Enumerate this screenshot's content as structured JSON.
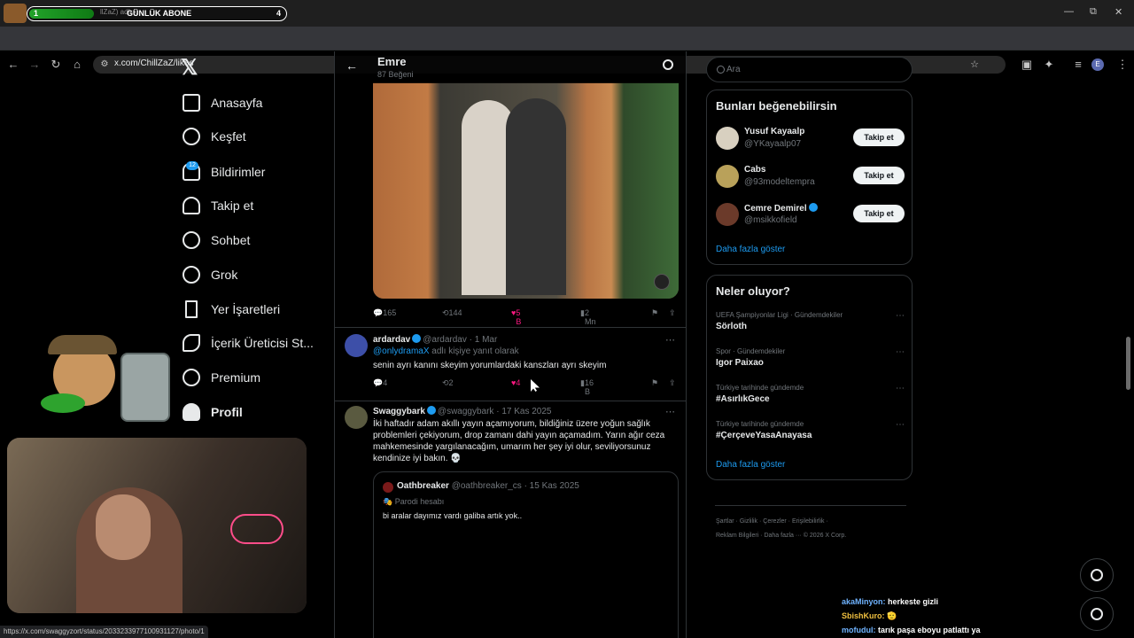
{
  "browser": {
    "url": "x.com/ChillZaZ/likes",
    "status_url": "https://x.com/swaggyzort/status/2033233977100931127/photo/1",
    "overlay": {
      "left": "1",
      "label": "GÜNLÜK ABONE",
      "right": "4",
      "ghost": "llZaZ) adlı k",
      "progress_fraction": 0.25
    },
    "win_min": "—",
    "win_max": "⧉",
    "win_close": "✕"
  },
  "nav": {
    "logo": "𝕏",
    "items": [
      {
        "label": "Anasayfa"
      },
      {
        "label": "Keşfet"
      },
      {
        "label": "Bildirimler"
      },
      {
        "label": "Takip et"
      },
      {
        "label": "Sohbet"
      },
      {
        "label": "Grok"
      },
      {
        "label": "Yer İşaretleri"
      },
      {
        "label": "İçerik Üreticisi St..."
      },
      {
        "label": "Premium"
      },
      {
        "label": "Profil"
      }
    ],
    "badge": "12"
  },
  "header": {
    "title": "Emre",
    "subtitle": "87 Beğeni"
  },
  "first_tweet": {
    "replies": "165",
    "reposts": "144",
    "likes": "5 B",
    "views": "2 Mn"
  },
  "tweets": [
    {
      "name": "ardardav",
      "handle": "@ardardav · 1 Mar",
      "reply_prefix": "@onlydramaX",
      "reply_suffix": " adlı kişiye yanıt olarak",
      "text": "senin ayrı kanını skeyim yorumlardaki kanszları ayrı skeyim",
      "replies": "4",
      "reposts": "2",
      "likes": "4",
      "views": "16 B"
    },
    {
      "name": "Swaggybark",
      "handle": "@swaggybark · 17 Kas 2025",
      "text": "İki haftadır adam akıllı yayın açamıyorum, bildiğiniz üzere yoğun sağlık problemleri çekiyorum, drop zamanı dahi yayın açamadım. Yarın ağır ceza mahkemesinde yargılanacağım, umarım her şey iyi olur, seviliyorsunuz kendinize iyi bakın. 💀",
      "quote": {
        "name": "Oathbreaker",
        "handle": "@oathbreaker_cs · 15 Kas 2025",
        "parody": "🎭 Parodi hesabı",
        "text": "bi aralar dayımız vardı galiba artık yok.."
      }
    }
  ],
  "search": {
    "placeholder": "Ara"
  },
  "who_to_follow": {
    "title": "Bunları beğenebilirsin",
    "users": [
      {
        "name": "Yusuf Kayaalp",
        "handle": "@YKayaalp07",
        "button": "Takip et"
      },
      {
        "name": "Cabs",
        "handle": "@93modeltempra",
        "button": "Takip et"
      },
      {
        "name": "Cemre Demirel",
        "handle": "@msikkofield",
        "button": "Takip et"
      }
    ],
    "more": "Daha fazla göster"
  },
  "trends": {
    "title": "Neler oluyor?",
    "items": [
      {
        "context": "UEFA Şampiyonlar Ligi · Gündemdekiler",
        "topic": "Sörloth"
      },
      {
        "context": "Spor · Gündemdekiler",
        "topic": "Igor Paixao"
      },
      {
        "context": "Türkiye tarihinde gündemde",
        "topic": "#AsırlıkGece"
      },
      {
        "context": "Türkiye tarihinde gündemde",
        "topic": "#ÇerçeveYasaAnayasa"
      }
    ],
    "more": "Daha fazla göster"
  },
  "footer": {
    "line1": "Şartlar  ·  Gizlilik  ·  Çerezler  ·  Erişilebilirlik  ·",
    "line2": "Reklam Bilgileri  ·  Daha fazla ···  © 2026 X Corp."
  },
  "stream_chat": [
    {
      "user": "akaMinyon:",
      "msg": " herkeste gizli"
    },
    {
      "user": "SbishKuro:",
      "msg": " 🫡"
    },
    {
      "user": "mofudul:",
      "msg": " tarık paşa eboyu patlattı ya"
    }
  ],
  "colors": {
    "accent": "#1d9bf0",
    "like": "#f91880",
    "bg": "#000000"
  }
}
